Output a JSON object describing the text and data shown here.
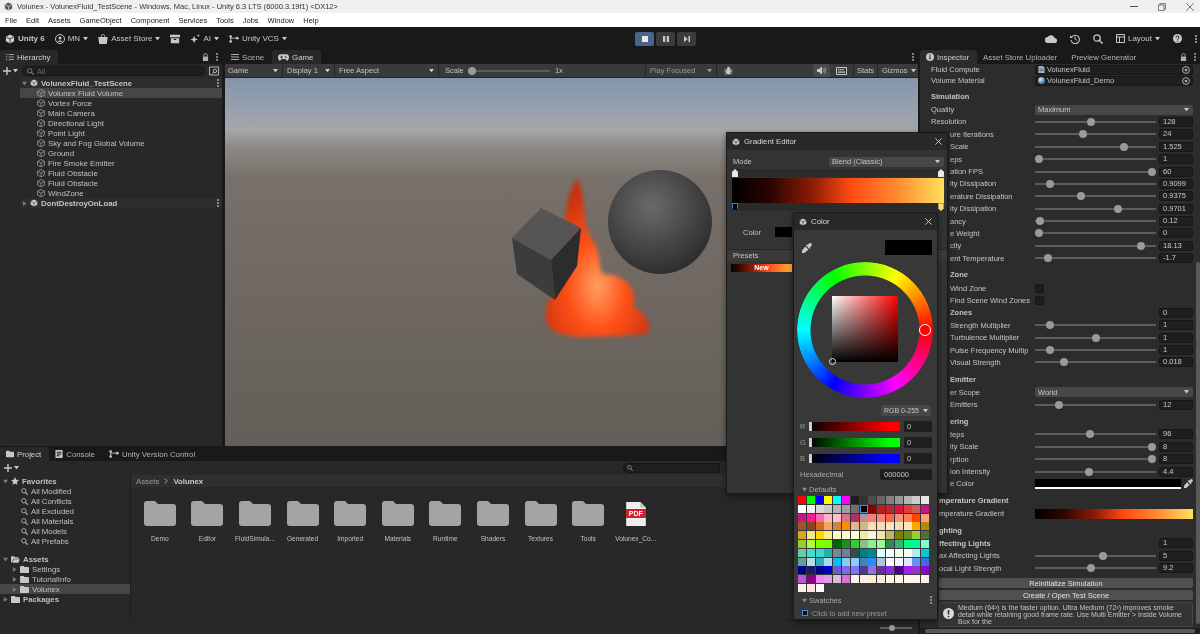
{
  "window": {
    "title": "Volunex - VolunexFluid_TestScene - Windows, Mac, Linux - Unity 6.3 LTS (6000.3.19f1) <DX12>"
  },
  "menu": [
    "File",
    "Edit",
    "Assets",
    "GameObject",
    "Component",
    "Services",
    "Tools",
    "Jobs",
    "Window",
    "Help"
  ],
  "toolbar": {
    "left": [
      {
        "kind": "brand",
        "label": "Unity 6"
      },
      {
        "kind": "account",
        "label": "MN"
      },
      {
        "kind": "store",
        "label": "Asset Store"
      },
      {
        "kind": "package"
      },
      {
        "kind": "ai",
        "label": "AI"
      },
      {
        "kind": "vcs",
        "label": "Unity VCS"
      }
    ],
    "play": [
      {
        "kind": "stop",
        "on": true
      },
      {
        "kind": "pause",
        "on": false
      },
      {
        "kind": "step",
        "on": false
      }
    ],
    "right": [
      {
        "kind": "cloud"
      },
      {
        "kind": "history"
      },
      {
        "kind": "search"
      },
      {
        "kind": "layout",
        "label": "Layout"
      },
      {
        "kind": "help"
      },
      {
        "kind": "more"
      }
    ]
  },
  "hierarchy": {
    "tabs": [
      {
        "label": "Hierarchy",
        "selected": true
      }
    ],
    "search": {
      "placeholder": "All"
    },
    "scenes": [
      {
        "name": "VolunexFluid_TestScene",
        "expanded": true,
        "selected": false,
        "children": [
          {
            "name": "Volunex Fluid Volume",
            "selected": true
          },
          {
            "name": "Vortex Force",
            "selected": false
          },
          {
            "name": "Main Camera",
            "selected": false
          },
          {
            "name": "Directional Light",
            "selected": false
          },
          {
            "name": "Point Light",
            "selected": false
          },
          {
            "name": "Sky and Fog Global Volume",
            "selected": false
          },
          {
            "name": "Ground",
            "selected": false
          },
          {
            "name": "Fire Smoke Emitter",
            "selected": false
          },
          {
            "name": "Fluid Obstacle",
            "selected": false
          },
          {
            "name": "Fluid Obstacle",
            "selected": false
          },
          {
            "name": "WindZone",
            "selected": false
          }
        ]
      },
      {
        "name": "DontDestroyOnLoad",
        "expanded": false,
        "selected": false
      }
    ]
  },
  "game_panel": {
    "tabs": [
      {
        "kind": "scene",
        "label": "Scene",
        "selected": false
      },
      {
        "kind": "game",
        "label": "Game",
        "selected": true
      }
    ],
    "toolbar": {
      "view": "Game",
      "display": "Display 1",
      "aspect": "Free Aspect",
      "scale": {
        "label": "Scale",
        "level": 0,
        "reading": "1x"
      },
      "play_mode": {
        "label": "Play Focused",
        "disabled": true
      },
      "stats": "Stats",
      "gizmos": "Gizmos"
    }
  },
  "inspector": {
    "tabs": [
      {
        "kind": "inspector",
        "label": "Inspector",
        "selected": true
      },
      {
        "kind": "plain",
        "label": "Asset Store Uploader",
        "selected": false
      },
      {
        "kind": "plain",
        "label": "Preview Generator",
        "selected": false
      }
    ],
    "sections": [
      {
        "rows": [
          {
            "kind": "compute",
            "label": "Fluid Compute",
            "value": "VolunexFluid"
          },
          {
            "kind": "material",
            "label": "Volume Material",
            "value": "VolunexFluid_Demo"
          }
        ]
      },
      {
        "title": "Simulation",
        "rows": [
          {
            "kind": "dropdown",
            "label": "Quality",
            "value": "Maximum"
          },
          {
            "kind": "slider",
            "label": "Resolution",
            "level": 0.46,
            "value": "128"
          },
          {
            "kind": "slider",
            "label": "ure Iterations",
            "level": 0.39,
            "value": "24"
          },
          {
            "kind": "slider",
            "label": "Scale",
            "level": 0.75,
            "value": "1.525"
          },
          {
            "kind": "slider",
            "label": "eps",
            "level": 0,
            "value": "1"
          },
          {
            "kind": "slider",
            "label": "ation FPS",
            "level": 1,
            "value": "60"
          },
          {
            "kind": "slider",
            "label": "ity Dissipation",
            "level": 0.1,
            "value": "0.9099"
          },
          {
            "kind": "slider",
            "label": "erature Dissipation",
            "level": 0.375,
            "value": "0.9375"
          },
          {
            "kind": "slider",
            "label": "ity Dissipation",
            "level": 0.7,
            "value": "0.9701"
          },
          {
            "kind": "slider",
            "label": "ancy",
            "level": 0.01,
            "value": "0.12"
          },
          {
            "kind": "slider",
            "label": "e Weight",
            "level": 0,
            "value": "0"
          },
          {
            "kind": "slider",
            "label": "city",
            "level": 0.9,
            "value": "18.13"
          },
          {
            "kind": "slider",
            "label": "ent Temperature",
            "level": 0.08,
            "value": "-1.7"
          }
        ]
      },
      {
        "title": "Zone",
        "rows": [
          {
            "kind": "checkbox",
            "label": "Wind Zone",
            "checked": false
          },
          {
            "kind": "checkbox",
            "label": "Find Scene Wind Zones",
            "checked": false
          },
          {
            "kind": "count",
            "label": "Zones",
            "value": "0"
          },
          {
            "kind": "slider",
            "label": "Strength Multiplier",
            "level": 0.1,
            "value": "1"
          },
          {
            "kind": "slider",
            "label": "Turbulence Multiplier",
            "level": 0.5,
            "value": "1"
          },
          {
            "kind": "slider",
            "label": "Pulse Frequency Multip",
            "level": 0.1,
            "value": "1"
          },
          {
            "kind": "slider",
            "label": "Visual Strength",
            "level": 0.22,
            "value": "0.018"
          }
        ]
      },
      {
        "title": "Emitter",
        "rows": [
          {
            "kind": "dropdown",
            "label": "er Scope",
            "value": "World"
          },
          {
            "kind": "slider",
            "label": "Emitters",
            "level": 0.18,
            "value": "12"
          }
        ]
      },
      {
        "title": "ering",
        "rows": [
          {
            "kind": "slider",
            "label": "teps",
            "level": 0.455,
            "value": "96"
          },
          {
            "kind": "slider",
            "label": "ity Scale",
            "level": 1,
            "value": "8"
          },
          {
            "kind": "slider",
            "label": "rption",
            "level": 1,
            "value": "8"
          },
          {
            "kind": "slider",
            "label": "ion Intensity",
            "level": 0.44,
            "value": "4.4"
          },
          {
            "kind": "color",
            "label": "e Color"
          }
        ]
      },
      {
        "title": "mperature Gradient",
        "rows": [
          {
            "kind": "gradient",
            "label": "mperature Gradient"
          }
        ]
      },
      {
        "title": "ghting",
        "rows": [
          {
            "kind": "count",
            "label": "ffecting Lights",
            "value": "1"
          },
          {
            "kind": "slider",
            "label": "ax Affecting Lights",
            "level": 0.57,
            "value": "5"
          },
          {
            "kind": "slider",
            "label": "ocal Light Strength",
            "level": 0.46,
            "value": "9.2"
          }
        ]
      }
    ],
    "actions": [
      "Reinitialize Simulation",
      "Create / Open Test Scene"
    ],
    "help": "Medium (64³) is the faster option. Ultra Medium (72³) improves smoke detail while retaining good frame rate. Use Multi Emitter > Inside Volume Box for the"
  },
  "gradient_editor": {
    "title": "Gradient Editor",
    "mode_label": "Mode",
    "mode": "Blend (Classic)",
    "alpha_keys": [
      {
        "level": 0,
        "selected": false
      },
      {
        "level": 1,
        "selected": false
      }
    ],
    "color_keys": [
      {
        "level": 0,
        "selected": true,
        "color": "#000000"
      },
      {
        "level": 1,
        "selected": false,
        "color": "#ffe25a"
      }
    ],
    "color_label": "Color",
    "presets_label": "Presets",
    "presets": [
      {
        "label": "New"
      }
    ]
  },
  "color_picker": {
    "title": "Color",
    "mode": "RGB 0-255",
    "channels": [
      {
        "name": "R",
        "color": "#ff0000",
        "level": 0,
        "value": "0"
      },
      {
        "name": "G",
        "color": "#00ff00",
        "level": 0,
        "value": "0"
      },
      {
        "name": "B",
        "color": "#0000ff",
        "level": 0,
        "value": "0"
      }
    ],
    "hex_label": "Hexadecimal",
    "hex": "000000",
    "defaults": {
      "label": "Defaults",
      "expanded": true,
      "swatches": [
        {
          "color": "#ff0000",
          "selected": false
        },
        {
          "color": "#00ff00",
          "selected": false
        },
        {
          "color": "#0000ff",
          "selected": false
        },
        {
          "color": "#ffff00",
          "selected": false
        },
        {
          "color": "#00ffff",
          "selected": false
        },
        {
          "color": "#ff00ff",
          "selected": false
        },
        {
          "color": "#1e1e1e",
          "selected": false
        },
        {
          "color": "#333333",
          "selected": false
        },
        {
          "color": "#4d4d4d",
          "selected": false
        },
        {
          "color": "#666666",
          "selected": false
        },
        {
          "color": "#808080",
          "selected": false
        },
        {
          "color": "#999999",
          "selected": false
        },
        {
          "color": "#b3b3b3",
          "selected": false
        },
        {
          "color": "#cccccc",
          "selected": false
        },
        {
          "color": "#e6e6e6",
          "selected": false
        },
        {
          "color": "#ffffff",
          "selected": false
        },
        {
          "color": "#f0f0f0",
          "selected": false
        },
        {
          "color": "#d9d9d9",
          "selected": false
        },
        {
          "color": "#c8c8c8",
          "selected": false
        },
        {
          "color": "#b4b4b4",
          "selected": false
        },
        {
          "color": "#a0a0a0",
          "selected": false
        },
        {
          "color": "#6e6e6e",
          "selected": false
        },
        {
          "color": "#000000",
          "selected": true
        },
        {
          "color": "#8b0000",
          "selected": false
        },
        {
          "color": "#b22222",
          "selected": false
        },
        {
          "color": "#c0272d",
          "selected": false
        },
        {
          "color": "#dc143c",
          "selected": false
        },
        {
          "color": "#e03c3c",
          "selected": false
        },
        {
          "color": "#cd5c5c",
          "selected": false
        },
        {
          "color": "#c71585",
          "selected": false
        },
        {
          "color": "#c71585",
          "selected": false
        },
        {
          "color": "#ff1493",
          "selected": false
        },
        {
          "color": "#ff69b4",
          "selected": false
        },
        {
          "color": "#ffb6c1",
          "selected": false
        },
        {
          "color": "#ffc0cb",
          "selected": false
        },
        {
          "color": "#db7093",
          "selected": false
        },
        {
          "color": "#b03060",
          "selected": false
        },
        {
          "color": "#bc8f8f",
          "selected": false
        },
        {
          "color": "#f08080",
          "selected": false
        },
        {
          "color": "#fa8072",
          "selected": false
        },
        {
          "color": "#ff6347",
          "selected": false
        },
        {
          "color": "#e9967a",
          "selected": false
        },
        {
          "color": "#ff7f50",
          "selected": false
        },
        {
          "color": "#ff4500",
          "selected": false
        },
        {
          "color": "#ffa07a",
          "selected": false
        },
        {
          "color": "#a0522d",
          "selected": false
        },
        {
          "color": "#8b4513",
          "selected": false
        },
        {
          "color": "#d2691e",
          "selected": false
        },
        {
          "color": "#f4a460",
          "selected": false
        },
        {
          "color": "#cd853f",
          "selected": false
        },
        {
          "color": "#ff8c00",
          "selected": false
        },
        {
          "color": "#deb887",
          "selected": false
        },
        {
          "color": "#d2b48c",
          "selected": false
        },
        {
          "color": "#ffdead",
          "selected": false
        },
        {
          "color": "#ffdab9",
          "selected": false
        },
        {
          "color": "#ffe4c4",
          "selected": false
        },
        {
          "color": "#f5deb3",
          "selected": false
        },
        {
          "color": "#ffe4b5",
          "selected": false
        },
        {
          "color": "#ffa500",
          "selected": false
        },
        {
          "color": "#b8860b",
          "selected": false
        },
        {
          "color": "#daa520",
          "selected": false
        },
        {
          "color": "#f0e68c",
          "selected": false
        },
        {
          "color": "#ffd700",
          "selected": false
        },
        {
          "color": "#ffec8b",
          "selected": false
        },
        {
          "color": "#fffacd",
          "selected": false
        },
        {
          "color": "#fafad2",
          "selected": false
        },
        {
          "color": "#ffffe0",
          "selected": false
        },
        {
          "color": "#eee8aa",
          "selected": false
        },
        {
          "color": "#f5f5dc",
          "selected": false
        },
        {
          "color": "#f0e6b0",
          "selected": false
        },
        {
          "color": "#bdb76b",
          "selected": false
        },
        {
          "color": "#808000",
          "selected": false
        },
        {
          "color": "#6b8e23",
          "selected": false
        },
        {
          "color": "#9acd32",
          "selected": false
        },
        {
          "color": "#556b2f",
          "selected": false
        },
        {
          "color": "#9acd32",
          "selected": false
        },
        {
          "color": "#adff2f",
          "selected": false
        },
        {
          "color": "#7fff00",
          "selected": false
        },
        {
          "color": "#7cfc00",
          "selected": false
        },
        {
          "color": "#006400",
          "selected": false
        },
        {
          "color": "#228b22",
          "selected": false
        },
        {
          "color": "#32cd32",
          "selected": false
        },
        {
          "color": "#8fbc8f",
          "selected": false
        },
        {
          "color": "#90ee90",
          "selected": false
        },
        {
          "color": "#98fb98",
          "selected": false
        },
        {
          "color": "#2e8b57",
          "selected": false
        },
        {
          "color": "#3cb371",
          "selected": false
        },
        {
          "color": "#00ff7f",
          "selected": false
        },
        {
          "color": "#00fa9a",
          "selected": false
        },
        {
          "color": "#7fffd4",
          "selected": false
        },
        {
          "color": "#66cdaa",
          "selected": false
        },
        {
          "color": "#40e0d0",
          "selected": false
        },
        {
          "color": "#48d1cc",
          "selected": false
        },
        {
          "color": "#20b2aa",
          "selected": false
        },
        {
          "color": "#778899",
          "selected": false
        },
        {
          "color": "#708090",
          "selected": false
        },
        {
          "color": "#2f4f4f",
          "selected": false
        },
        {
          "color": "#008080",
          "selected": false
        },
        {
          "color": "#008b8b",
          "selected": false
        },
        {
          "color": "#e0ffff",
          "selected": false
        },
        {
          "color": "#f0ffff",
          "selected": false
        },
        {
          "color": "#f0fff0",
          "selected": false
        },
        {
          "color": "#f5fffa",
          "selected": false
        },
        {
          "color": "#afeeee",
          "selected": false
        },
        {
          "color": "#00ced1",
          "selected": false
        },
        {
          "color": "#5f9ea0",
          "selected": false
        },
        {
          "color": "#b0e0e6",
          "selected": false
        },
        {
          "color": "#2bb0c0",
          "selected": false
        },
        {
          "color": "#add8e6",
          "selected": false
        },
        {
          "color": "#00bfff",
          "selected": false
        },
        {
          "color": "#87ceeb",
          "selected": false
        },
        {
          "color": "#87cefa",
          "selected": false
        },
        {
          "color": "#4682b4",
          "selected": false
        },
        {
          "color": "#1e90ff",
          "selected": false
        },
        {
          "color": "#b0c4de",
          "selected": false
        },
        {
          "color": "#f8f8ff",
          "selected": false
        },
        {
          "color": "#f0f8ff",
          "selected": false
        },
        {
          "color": "#e6e6fa",
          "selected": false
        },
        {
          "color": "#6495ed",
          "selected": false
        },
        {
          "color": "#4169e1",
          "selected": false
        },
        {
          "color": "#00008b",
          "selected": false
        },
        {
          "color": "#191970",
          "selected": false
        },
        {
          "color": "#000080",
          "selected": false
        },
        {
          "color": "#0000cd",
          "selected": false
        },
        {
          "color": "#6a5acd",
          "selected": false
        },
        {
          "color": "#7b68ee",
          "selected": false
        },
        {
          "color": "#8470ff",
          "selected": false
        },
        {
          "color": "#483d8b",
          "selected": false
        },
        {
          "color": "#9370db",
          "selected": false
        },
        {
          "color": "#663399",
          "selected": false
        },
        {
          "color": "#8a2be2",
          "selected": false
        },
        {
          "color": "#4b0082",
          "selected": false
        },
        {
          "color": "#a020f0",
          "selected": false
        },
        {
          "color": "#9932cc",
          "selected": false
        },
        {
          "color": "#9400d3",
          "selected": false
        },
        {
          "color": "#ba55d3",
          "selected": false
        },
        {
          "color": "#8b008b",
          "selected": false
        },
        {
          "color": "#ee82ee",
          "selected": false
        },
        {
          "color": "#dda0dd",
          "selected": false
        },
        {
          "color": "#d8bfd8",
          "selected": false
        },
        {
          "color": "#da70d6",
          "selected": false
        },
        {
          "color": "#fff0f5",
          "selected": false
        },
        {
          "color": "#faf0e6",
          "selected": false
        },
        {
          "color": "#ffebcd",
          "selected": false
        },
        {
          "color": "#faebd7",
          "selected": false
        },
        {
          "color": "#fff8dc",
          "selected": false
        },
        {
          "color": "#fdf5e6",
          "selected": false
        },
        {
          "color": "#fffaf0",
          "selected": false
        },
        {
          "color": "#fff5ee",
          "selected": false
        },
        {
          "color": "#fdf0e0",
          "selected": false
        },
        {
          "color": "#faf0e6",
          "selected": false
        },
        {
          "color": "#ffe4e1",
          "selected": false
        },
        {
          "color": "#fffafa",
          "selected": false
        }
      ]
    },
    "swatches": {
      "label": "Swatches",
      "expanded": true,
      "add_label": "Click to add new preset"
    }
  },
  "project": {
    "tabs": [
      {
        "kind": "project",
        "label": "Project",
        "selected": true
      },
      {
        "kind": "console",
        "label": "Console",
        "selected": false
      },
      {
        "kind": "vcs",
        "label": "Unity Version Control",
        "selected": false
      }
    ],
    "favorites": {
      "label": "Favorites",
      "expanded": true,
      "items": [
        {
          "name": "All Modified",
          "selected": false
        },
        {
          "name": "All Conflicts",
          "selected": false
        },
        {
          "name": "All Excluded",
          "selected": false
        },
        {
          "name": "All Materials",
          "selected": false
        },
        {
          "name": "All Models",
          "selected": false
        },
        {
          "name": "All Prefabs",
          "selected": false
        }
      ]
    },
    "folders": [
      {
        "name": "Assets",
        "expanded": true,
        "selected": false,
        "children": [
          {
            "name": "Settings",
            "expanded": false,
            "selected": false
          },
          {
            "name": "TutorialInfo",
            "expanded": false,
            "selected": false
          },
          {
            "name": "Volunex",
            "expanded": false,
            "selected": true
          }
        ]
      },
      {
        "name": "Packages",
        "expanded": false,
        "selected": false
      }
    ],
    "breadcrumb": [
      "Assets",
      "Volunex"
    ],
    "assets": [
      {
        "kind": "folder",
        "name": "Demo"
      },
      {
        "kind": "folder",
        "name": "Editor"
      },
      {
        "kind": "folder",
        "name": "FluidSimula..."
      },
      {
        "kind": "folder",
        "name": "Generated"
      },
      {
        "kind": "folder",
        "name": "Imported"
      },
      {
        "kind": "folder",
        "name": "Materials"
      },
      {
        "kind": "folder",
        "name": "Runtime"
      },
      {
        "kind": "folder",
        "name": "Shaders"
      },
      {
        "kind": "folder",
        "name": "Textures"
      },
      {
        "kind": "folder",
        "name": "Tools"
      },
      {
        "kind": "pdf",
        "name": "Volunex_Co...",
        "badge": "PDF"
      }
    ],
    "icon_size": {
      "level": 0.35
    }
  }
}
